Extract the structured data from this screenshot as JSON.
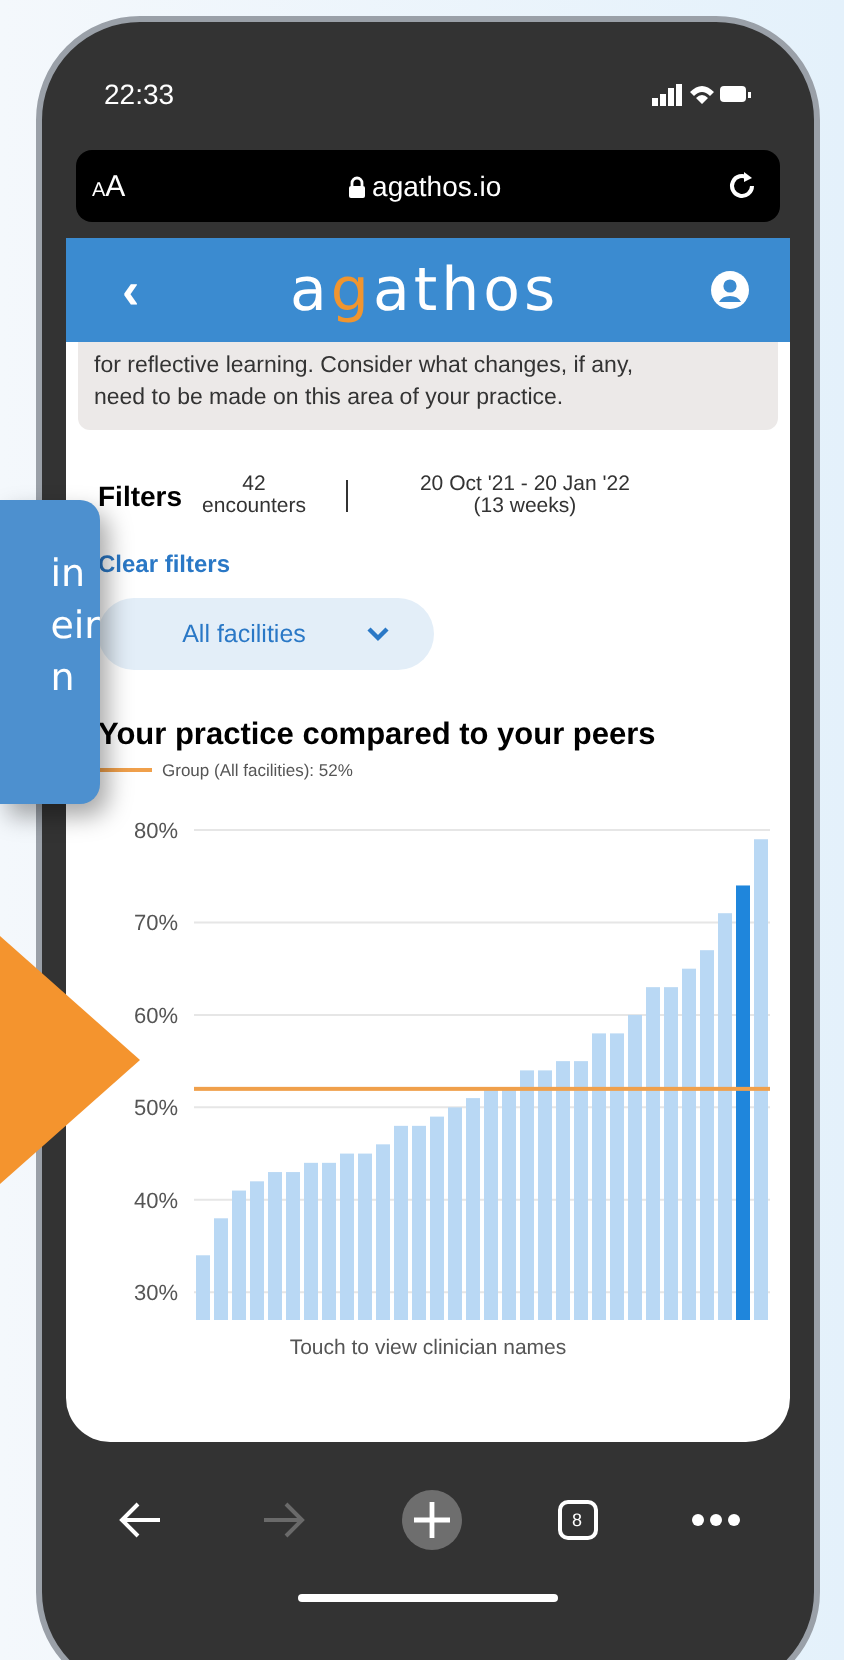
{
  "status_bar": {
    "time": "22:33"
  },
  "browser": {
    "text_size_button": "AA",
    "url": "agathos.io"
  },
  "header": {
    "back": "‹",
    "logo": [
      {
        "text": "a",
        "accent": false
      },
      {
        "text": "g",
        "accent": true
      },
      {
        "text": "athos",
        "accent": false
      }
    ]
  },
  "notice": {
    "lines": [
      "for reflective learning. Consider what changes, if any,",
      "need to be made on this area of your practice."
    ]
  },
  "filters": {
    "title": "Filters",
    "count": "42",
    "count_label": "encounters",
    "date_range": "20 Oct '21 - 20 Jan '22",
    "duration": "(13 weeks)",
    "clear": "Clear filters",
    "dropdown": "All facilities"
  },
  "chart": {
    "title": "Your practice compared to your peers",
    "chart_data": {
      "type": "bar",
      "stacked": true,
      "grid": true,
      "ylim": [
        27,
        80
      ],
      "yticks": [
        {
          "value": 30,
          "label": "30%"
        },
        {
          "value": 40,
          "label": "40%"
        },
        {
          "value": 50,
          "label": "50%"
        },
        {
          "value": 60,
          "label": "60%"
        },
        {
          "value": 70,
          "label": "70%"
        },
        {
          "value": 80,
          "label": "80%"
        }
      ],
      "series": [
        {
          "color": "#b9d8f4",
          "values": [
            34,
            38,
            41,
            42,
            43,
            43,
            44,
            44,
            45,
            45,
            46,
            48,
            48,
            49,
            50,
            51,
            52,
            52,
            54,
            54,
            55,
            55,
            58,
            58,
            60,
            63,
            63,
            65,
            67,
            71,
            null,
            79
          ]
        },
        {
          "color": "#1f86dc",
          "values": [
            null,
            null,
            null,
            null,
            null,
            null,
            null,
            null,
            null,
            null,
            null,
            null,
            null,
            null,
            null,
            null,
            null,
            null,
            null,
            null,
            null,
            null,
            null,
            null,
            null,
            null,
            null,
            null,
            null,
            null,
            74,
            null
          ]
        }
      ],
      "ref_lines": [
        {
          "axis": "y",
          "value": 52,
          "label": "Group (All facilities): 52%",
          "color": "#f0a04b"
        }
      ]
    },
    "footer": "Touch to view clinician names"
  },
  "toolbar": [
    {
      "kind": "back",
      "disabled": false
    },
    {
      "kind": "forward",
      "disabled": true
    },
    {
      "kind": "new-tab",
      "disabled": false
    },
    {
      "kind": "tabs",
      "label": "8",
      "disabled": false
    },
    {
      "kind": "more",
      "disabled": false
    }
  ],
  "callout": {
    "lines": [
      "in",
      "eir",
      "n"
    ]
  }
}
